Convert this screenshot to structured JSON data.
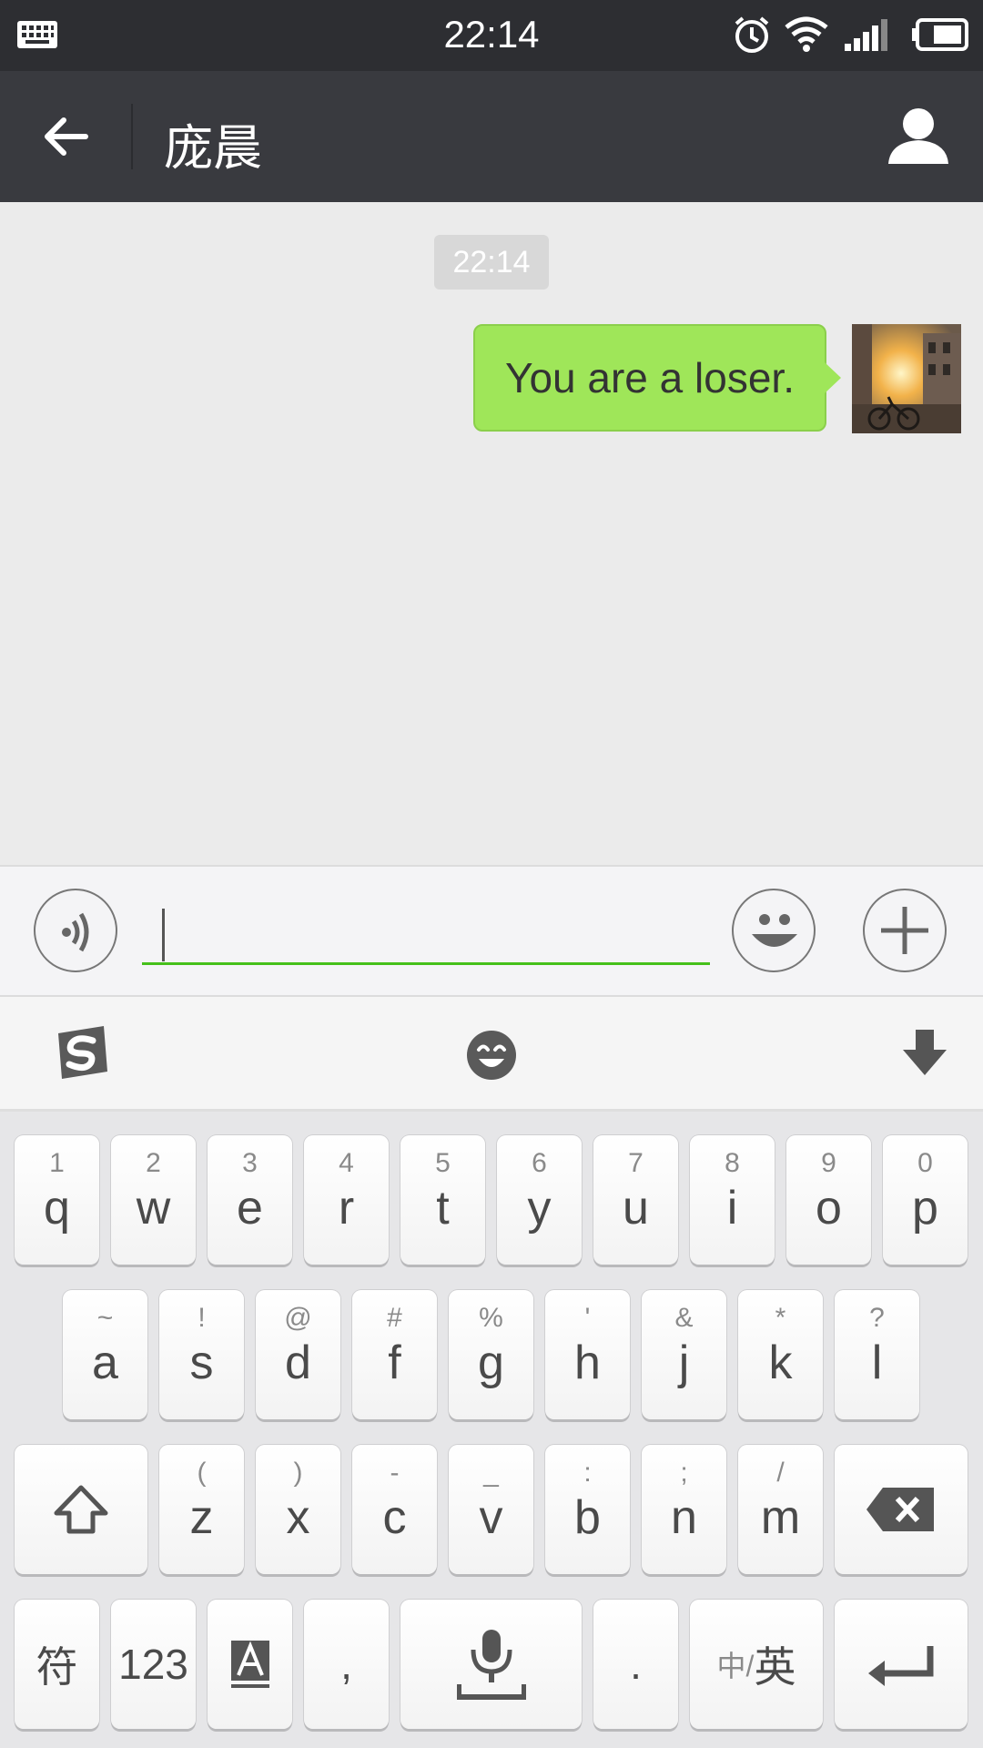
{
  "status_bar": {
    "time": "22:14"
  },
  "nav": {
    "title": "庞晨"
  },
  "chat": {
    "timestamp": "22:14",
    "messages": [
      {
        "text": "You are a loser.",
        "from": "me"
      }
    ]
  },
  "input": {
    "value": "",
    "placeholder": ""
  },
  "colors": {
    "accent_green": "#45c01a",
    "bubble_green": "#9fe659",
    "nav_bg": "#393a3f",
    "status_bg": "#2d2e32"
  },
  "keyboard": {
    "row1": [
      {
        "main": "q",
        "sub": "1"
      },
      {
        "main": "w",
        "sub": "2"
      },
      {
        "main": "e",
        "sub": "3"
      },
      {
        "main": "r",
        "sub": "4"
      },
      {
        "main": "t",
        "sub": "5"
      },
      {
        "main": "y",
        "sub": "6"
      },
      {
        "main": "u",
        "sub": "7"
      },
      {
        "main": "i",
        "sub": "8"
      },
      {
        "main": "o",
        "sub": "9"
      },
      {
        "main": "p",
        "sub": "0"
      }
    ],
    "row2": [
      {
        "main": "a",
        "sub": "~"
      },
      {
        "main": "s",
        "sub": "!"
      },
      {
        "main": "d",
        "sub": "@"
      },
      {
        "main": "f",
        "sub": "#"
      },
      {
        "main": "g",
        "sub": "%"
      },
      {
        "main": "h",
        "sub": "'"
      },
      {
        "main": "j",
        "sub": "&"
      },
      {
        "main": "k",
        "sub": "*"
      },
      {
        "main": "l",
        "sub": "?"
      }
    ],
    "row3": [
      {
        "main": "z",
        "sub": "("
      },
      {
        "main": "x",
        "sub": ")"
      },
      {
        "main": "c",
        "sub": "-"
      },
      {
        "main": "v",
        "sub": "_"
      },
      {
        "main": "b",
        "sub": ":"
      },
      {
        "main": "n",
        "sub": ";"
      },
      {
        "main": "m",
        "sub": "/"
      }
    ],
    "row4": {
      "symbols": "符",
      "numbers": "123",
      "comma": ",",
      "period": ".",
      "lang_small": "中/",
      "lang_big": "英"
    }
  }
}
